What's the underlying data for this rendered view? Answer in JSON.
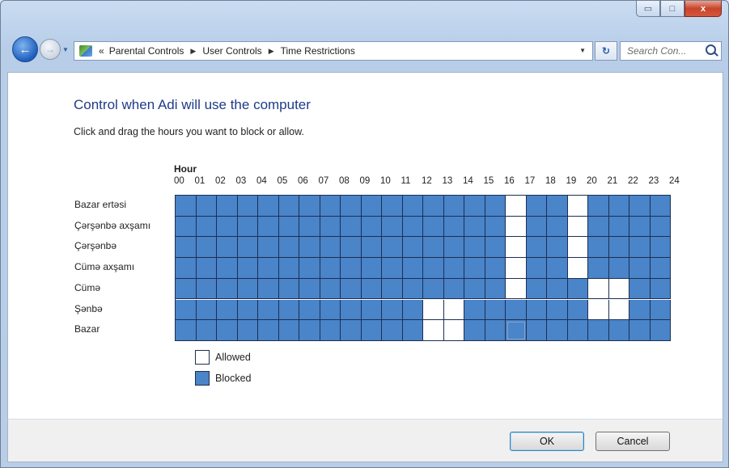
{
  "window": {
    "caption_buttons": {
      "minimize": "▭",
      "maximize": "□",
      "close": "x"
    }
  },
  "nav": {
    "back_icon": "back-arrow-icon",
    "forward_icon": "forward-arrow-icon",
    "overflow": "«",
    "breadcrumbs": [
      "Parental Controls",
      "User Controls",
      "Time Restrictions"
    ],
    "refresh_icon": "refresh-icon",
    "search_placeholder": "Search Con..."
  },
  "main": {
    "heading": "Control when Adi will use the computer",
    "instruction": "Click and drag the hours you want to block or allow.",
    "hour_label": "Hour",
    "hour_ticks": [
      "00",
      "01",
      "02",
      "03",
      "04",
      "05",
      "06",
      "07",
      "08",
      "09",
      "10",
      "11",
      "12",
      "13",
      "14",
      "15",
      "16",
      "17",
      "18",
      "19",
      "20",
      "21",
      "22",
      "23",
      "24"
    ],
    "days": [
      "Bazar ertəsi",
      "Çərşənbə axşamı",
      "Çərşənbə",
      "Cümə axşamı",
      "Cümə",
      "Şənbə",
      "Bazar"
    ],
    "schedule": {
      "columns": 24,
      "allowed_hours": [
        [
          16,
          19
        ],
        [
          16,
          19
        ],
        [
          16,
          19
        ],
        [
          16,
          19
        ],
        [
          16,
          20,
          21
        ],
        [
          12,
          13,
          20,
          21
        ],
        [
          12,
          13
        ]
      ],
      "focused_cell": {
        "day": 6,
        "hour": 16
      },
      "colors": {
        "allowed": "#ffffff",
        "blocked": "#4a84c9",
        "grid": "#1c2f52"
      }
    },
    "legend": [
      {
        "label": "Allowed",
        "color": "#ffffff"
      },
      {
        "label": "Blocked",
        "color": "#4a84c9"
      }
    ]
  },
  "footer": {
    "ok_label": "OK",
    "cancel_label": "Cancel"
  }
}
